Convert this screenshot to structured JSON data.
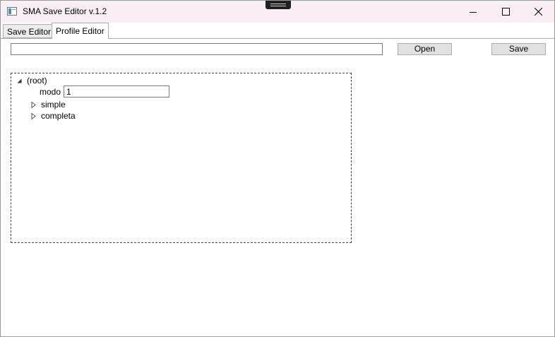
{
  "window": {
    "title": "SMA Save Editor v.1.2",
    "titlebar_color": "#f9eef4"
  },
  "tabs": [
    {
      "label": "Save Editor",
      "active": false
    },
    {
      "label": "Profile Editor",
      "active": true
    }
  ],
  "toolbar": {
    "path_value": "",
    "open_label": "Open",
    "save_label": "Save"
  },
  "tree": {
    "root_label": "(root)",
    "modo_label": "modo",
    "modo_value": "1",
    "children": [
      {
        "label": "simple",
        "expanded": false
      },
      {
        "label": "completa",
        "expanded": false
      }
    ]
  },
  "icons": [
    "app-icon",
    "minimize-icon",
    "maximize-icon",
    "close-icon",
    "collapse-triangle-icon",
    "expand-triangle-icon"
  ]
}
